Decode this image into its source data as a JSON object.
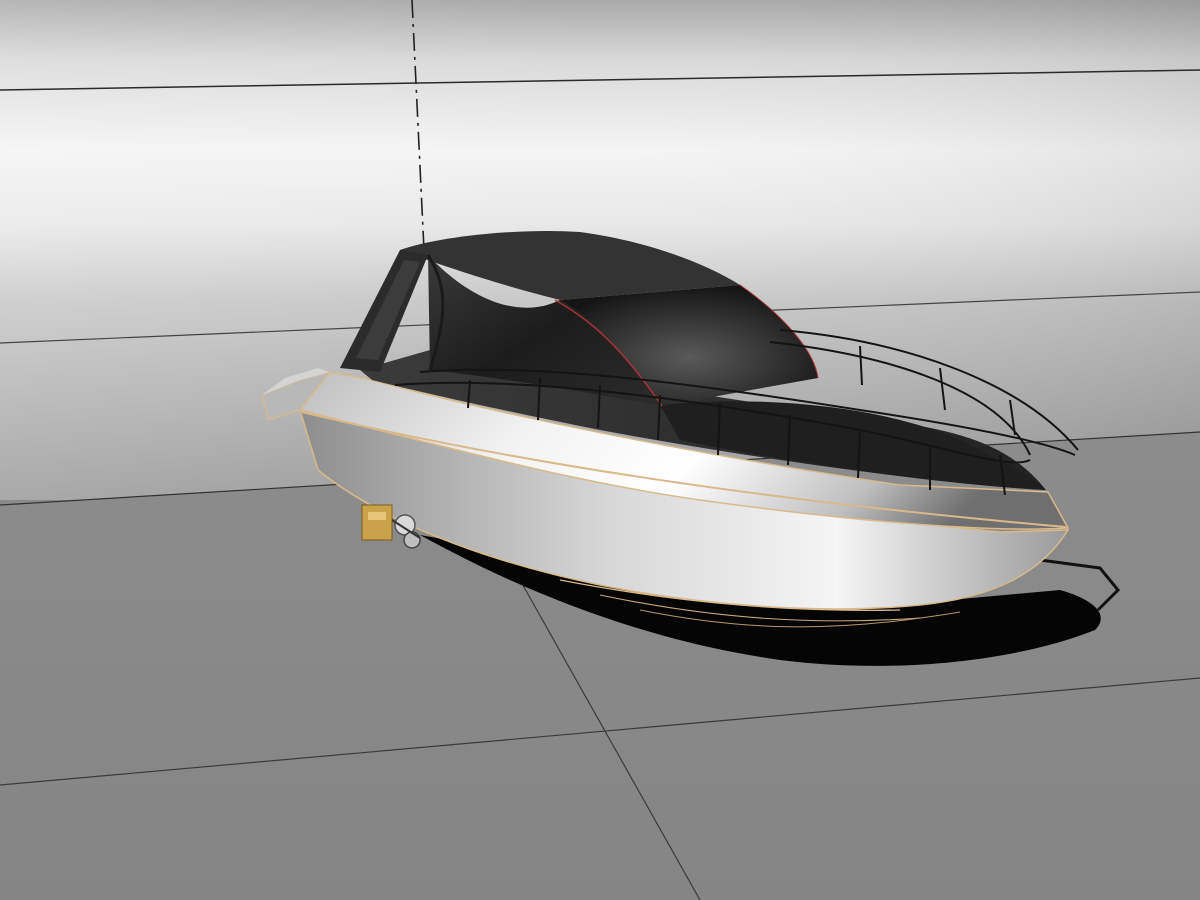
{
  "viewport": {
    "kind": "3d-render-viewport",
    "object": "motor-yacht-model",
    "colors": {
      "backdrop_light": "#f4f4f4",
      "backdrop_mid": "#cfcfcf",
      "floor": "#8d8d8d",
      "hull": "#d9d9d9",
      "canopy": "#262626",
      "edge_highlight": "#d9b98a",
      "shadow": "#000000",
      "axis_line": "#222222"
    }
  }
}
